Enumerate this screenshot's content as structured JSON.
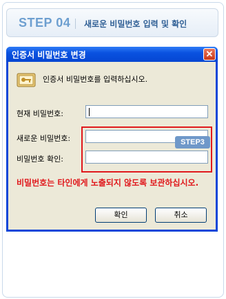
{
  "step": {
    "number": "STEP 04",
    "title": "새로운 비밀번호 입력 및 확인"
  },
  "dialog": {
    "title": "인증서 비밀번호 변경",
    "close_icon": "close-icon",
    "prompt": "인증서 비밀번호를 입력하십시오.",
    "fields": {
      "current_label": "현재 비밀번호:",
      "current_value": "",
      "new_label": "새로운 비밀번호:",
      "new_value": "",
      "confirm_label": "비밀번호 확인:",
      "confirm_value": ""
    },
    "step3_badge": "STEP3",
    "warning": "비밀번호는 타인에게 노출되지 않도록 보관하십시오.",
    "ok_label": "확인",
    "cancel_label": "취소"
  },
  "colors": {
    "titlebar": "#0a52e0",
    "highlight": "#e0181c",
    "badge": "#6f98c9"
  }
}
